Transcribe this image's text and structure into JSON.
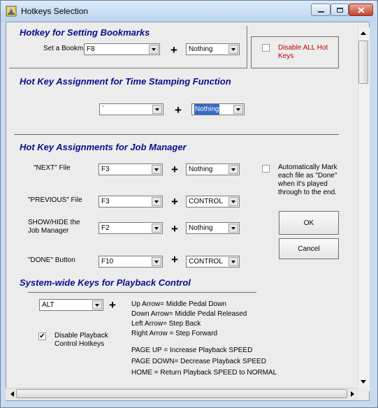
{
  "window": {
    "title": "Hotkeys Selection"
  },
  "bookmarks": {
    "title": "Hotkey for Setting Bookmarks",
    "label": "Set a Bookmark",
    "key": "F8",
    "modifier": "Nothing",
    "plus": "+"
  },
  "disable_all": {
    "label_line1": "Disable ALL Hot",
    "label_line2": "Keys",
    "checked": false
  },
  "timestamp": {
    "title": "Hot Key Assignment for Time Stamping Function",
    "key": "`",
    "modifier": "Nothing",
    "plus": "+"
  },
  "job_manager": {
    "title": "Hot Key Assignments for Job Manager",
    "rows": [
      {
        "label1": "\"NEXT\" File",
        "label2": "",
        "key": "F3",
        "modifier": "Nothing",
        "plus": "+"
      },
      {
        "label1": "\"PREVIOUS\" File",
        "label2": "",
        "key": "F3",
        "modifier": "CONTROL",
        "plus": "+"
      },
      {
        "label1": "SHOW/HIDE the",
        "label2": "Job Manager",
        "key": "F2",
        "modifier": "Nothing",
        "plus": "+"
      },
      {
        "label1": "\"DONE\" Button",
        "label2": "",
        "key": "F10",
        "modifier": "CONTROL",
        "plus": "+"
      }
    ],
    "auto_mark": {
      "line1": "Automatically Mark",
      "line2": "each file as \"Done\"",
      "line3": "when it's played",
      "line4": "through to the end.",
      "checked": false
    },
    "ok_label": "OK",
    "cancel_label": "Cancel"
  },
  "playback": {
    "title": "System-wide Keys for Playback Control",
    "modifier": "ALT",
    "plus": "+",
    "disable_line1": "Disable Playback",
    "disable_line2": "Control Hotkeys",
    "disable_checked": true,
    "check_glyph": "✔",
    "keys": [
      "Up Arrow= Middle Pedal Down",
      "Down Arrow= Middle Pedal Released",
      "Left Arrow= Step Back",
      "Right Arrow = Step Forward"
    ],
    "speed_keys": [
      "PAGE UP = Increase Playback SPEED",
      "PAGE DOWN= Decrease Playback SPEED",
      "HOME = Return Playback SPEED to NORMAL"
    ]
  }
}
